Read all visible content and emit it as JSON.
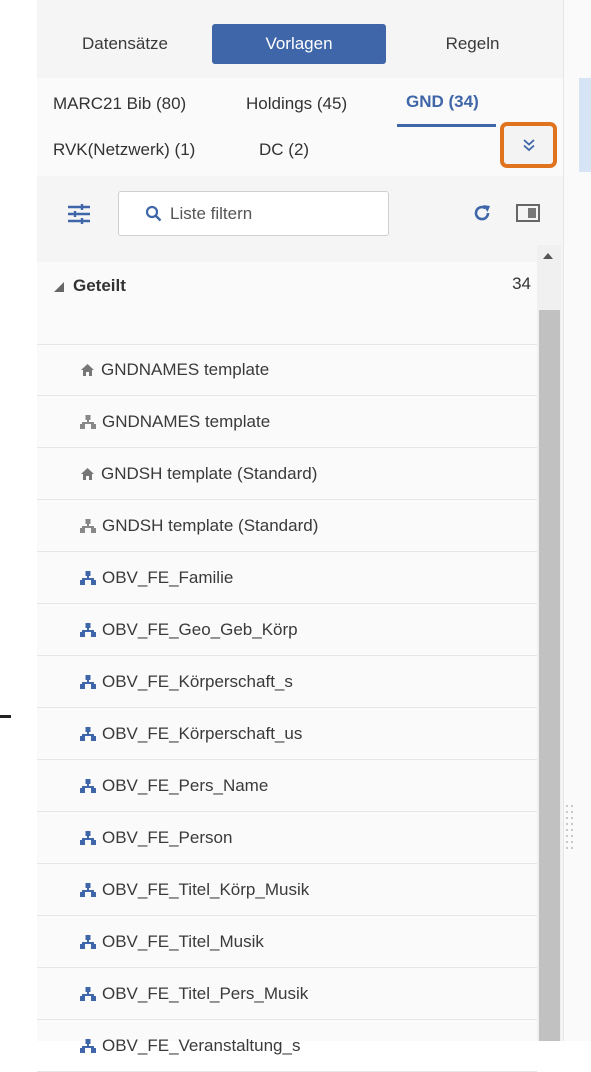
{
  "top_tabs": {
    "records": "Datensätze",
    "templates": "Vorlagen",
    "rules": "Regeln"
  },
  "type_tabs": {
    "marc": "MARC21 Bib (80)",
    "holdings": "Holdings (45)",
    "gnd": "GND (34)",
    "rvk": "RVK(Netzwerk) (1)",
    "dc": "DC (2)"
  },
  "toolbar": {
    "filter_placeholder": "Liste filtern"
  },
  "group": {
    "label": "Geteilt",
    "count": "34"
  },
  "templates": [
    {
      "label": "GNDNAMES template",
      "icon": "home-icon"
    },
    {
      "label": "GNDNAMES template",
      "icon": "hierarchy-icon"
    },
    {
      "label": "GNDSH template  (Standard)",
      "icon": "home-icon"
    },
    {
      "label": "GNDSH template  (Standard)",
      "icon": "hierarchy-icon"
    },
    {
      "label": "OBV_FE_Familie",
      "icon": "hierarchy-icon-blue"
    },
    {
      "label": "OBV_FE_Geo_Geb_Körp",
      "icon": "hierarchy-icon-blue"
    },
    {
      "label": "OBV_FE_Körperschaft_s",
      "icon": "hierarchy-icon-blue"
    },
    {
      "label": "OBV_FE_Körperschaft_us",
      "icon": "hierarchy-icon-blue"
    },
    {
      "label": "OBV_FE_Pers_Name",
      "icon": "hierarchy-icon-blue"
    },
    {
      "label": "OBV_FE_Person",
      "icon": "hierarchy-icon-blue"
    },
    {
      "label": "OBV_FE_Titel_Körp_Musik",
      "icon": "hierarchy-icon-blue"
    },
    {
      "label": "OBV_FE_Titel_Musik",
      "icon": "hierarchy-icon-blue"
    },
    {
      "label": "OBV_FE_Titel_Pers_Musik",
      "icon": "hierarchy-icon-blue"
    },
    {
      "label": "OBV_FE_Veranstaltung_s",
      "icon": "hierarchy-icon-blue"
    }
  ],
  "colors": {
    "accent": "#3f66a8",
    "highlight_border": "#e0741e"
  }
}
